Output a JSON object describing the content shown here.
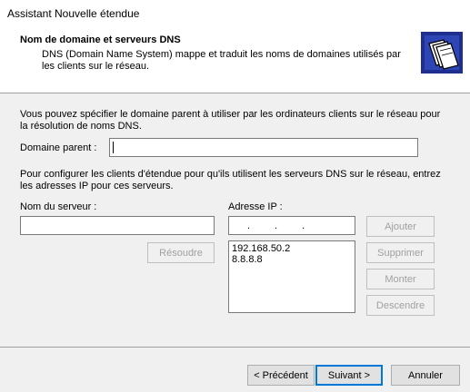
{
  "window": {
    "title": "Assistant Nouvelle étendue"
  },
  "header": {
    "title": "Nom de domaine et serveurs DNS",
    "description": "DNS (Domain Name System) mappe et traduit les noms de domaines utilisés par les clients sur le réseau."
  },
  "parent_domain": {
    "intro": "Vous pouvez spécifier le domaine parent à utiliser par les ordinateurs clients sur le réseau pour la résolution de noms DNS.",
    "label": "Domaine parent :",
    "value": ""
  },
  "dns_servers": {
    "intro": "Pour configurer les clients d'étendue pour qu'ils utilisent les serveurs DNS sur le réseau, entrez les adresses IP pour ces serveurs.",
    "server_name_label": "Nom du serveur :",
    "server_name_value": "",
    "ip_label": "Adresse IP :",
    "ip_field_dots": "...",
    "resolve_label": "Résoudre",
    "ip_list": [
      "192.168.50.2",
      "8.8.8.8"
    ],
    "add_label": "Ajouter",
    "remove_label": "Supprimer",
    "up_label": "Monter",
    "down_label": "Descendre"
  },
  "footer": {
    "back_label": "< Précédent",
    "next_label": "Suivant >",
    "cancel_label": "Annuler"
  },
  "icons": {
    "wizard": "folders-icon"
  }
}
